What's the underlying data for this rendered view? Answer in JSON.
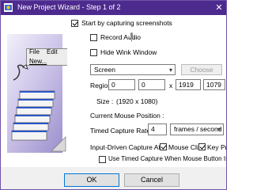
{
  "window": {
    "title": "New Project Wizard - Step 1 of 2",
    "close_glyph": "✕"
  },
  "illustration": {
    "menu_file": "File",
    "menu_edit": "Edit",
    "item_new": "New..."
  },
  "options": {
    "start_capturing": {
      "label": "Start by capturing screenshots",
      "checked": true
    },
    "record_audio": {
      "label": "Record Audio",
      "checked": false,
      "icon": "microphone-icon"
    },
    "hide_wink": {
      "label": "Hide Wink Window",
      "checked": false
    }
  },
  "screen_select": {
    "value": "Screen",
    "choose_label": "Choose"
  },
  "region": {
    "label": "Region :",
    "x": "0",
    "y": "0",
    "times": "x",
    "width": "1919",
    "height": "1079"
  },
  "size": {
    "label": "Size :",
    "value": "(1920 x 1080)"
  },
  "mouse_position": {
    "label": "Current Mouse Position :"
  },
  "timed_capture": {
    "label": "Timed Capture Rate",
    "value": "4",
    "unit": "frames / second"
  },
  "input_driven": {
    "label": "Input-Driven Capture At",
    "mouse_click": {
      "label": "Mouse Click",
      "checked": true
    },
    "key_press": {
      "label": "Key Press",
      "checked": true
    },
    "timed_when_down": {
      "label": "Use Timed Capture When Mouse Button Is Down",
      "checked": false
    }
  },
  "buttons": {
    "ok": "OK",
    "cancel": "Cancel"
  }
}
